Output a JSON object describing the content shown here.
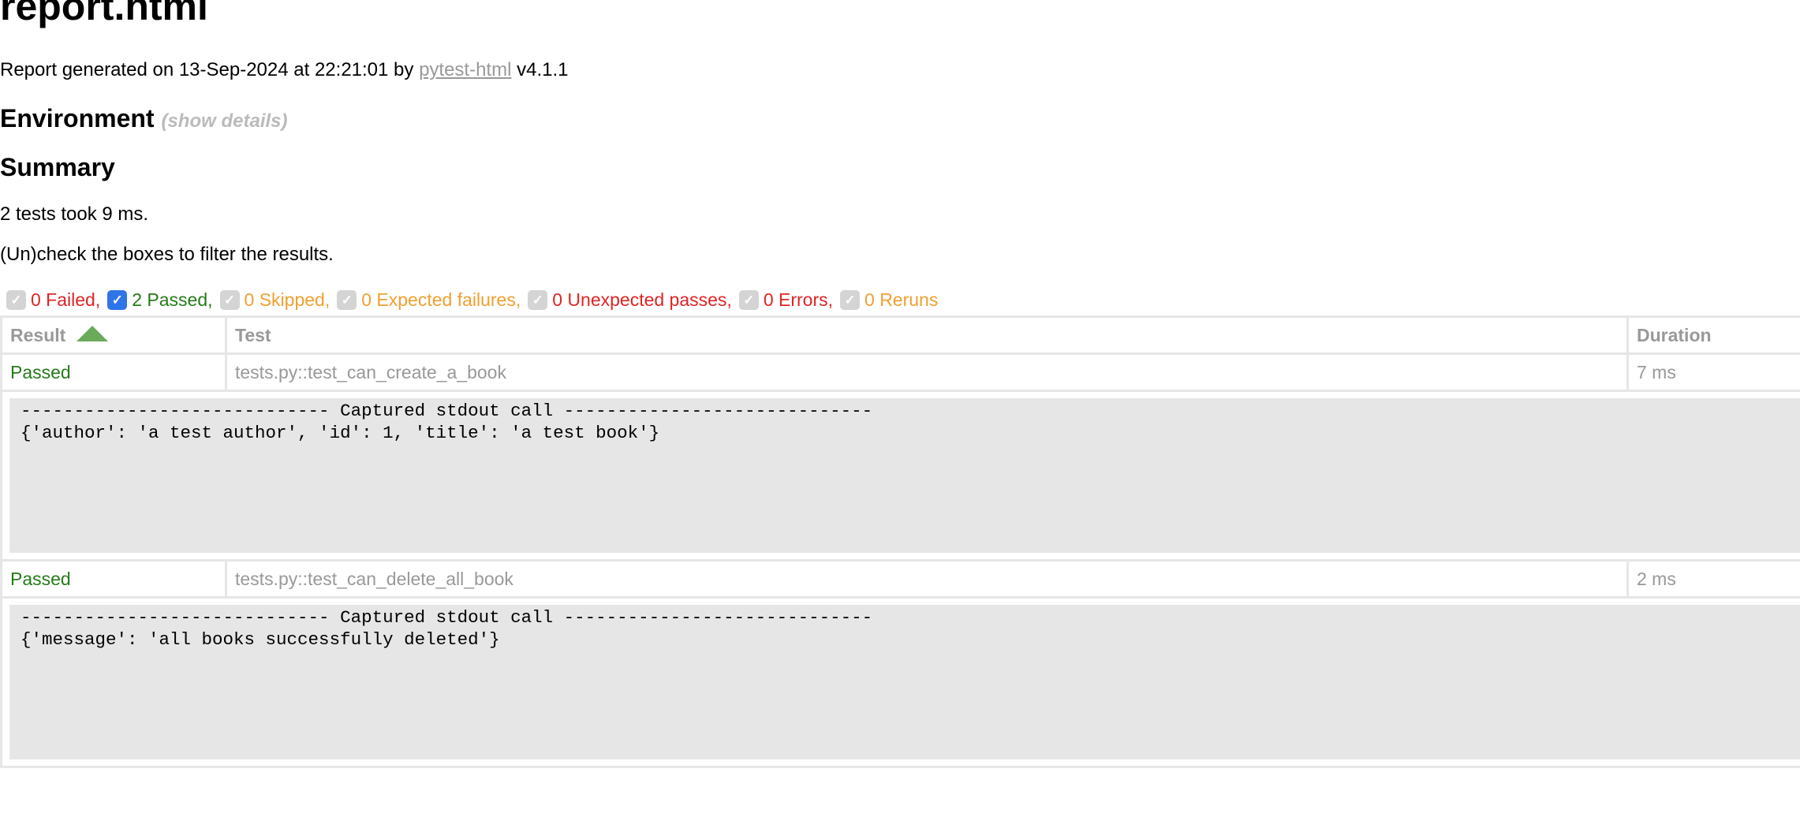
{
  "header": {
    "title": "report.html",
    "generated_prefix": "Report generated on 13-Sep-2024 at 22:21:01 by ",
    "generator_link": "pytest-html",
    "generator_version": " v4.1.1"
  },
  "environment": {
    "heading": "Environment",
    "toggle_label": "(show details)"
  },
  "summary": {
    "heading": "Summary",
    "run_count": "2 tests took 9 ms.",
    "filter_hint": "(Un)check the boxes to filter the results.",
    "filters": [
      {
        "label": "0 Failed,",
        "checked": true,
        "disabled": true,
        "color": "#e02424"
      },
      {
        "label": "2 Passed,",
        "checked": true,
        "disabled": false,
        "color": "#267a1a"
      },
      {
        "label": "0 Skipped,",
        "checked": true,
        "disabled": true,
        "color": "#f0a030"
      },
      {
        "label": "0 Expected failures,",
        "checked": true,
        "disabled": true,
        "color": "#f0a030"
      },
      {
        "label": "0 Unexpected passes,",
        "checked": true,
        "disabled": true,
        "color": "#e02424"
      },
      {
        "label": "0 Errors,",
        "checked": true,
        "disabled": true,
        "color": "#e02424"
      },
      {
        "label": "0 Reruns",
        "checked": true,
        "disabled": true,
        "color": "#f0a030"
      }
    ],
    "checkbox_icon": "checkmark-icon"
  },
  "table": {
    "columns": [
      "Result",
      "Test",
      "Duration"
    ],
    "sort_icon": "sort-ascending-icon",
    "rows": [
      {
        "result": "Passed",
        "test": "tests.py::test_can_create_a_book",
        "duration": "7 ms",
        "log": "----------------------------- Captured stdout call -----------------------------\n{'author': 'a test author', 'id': 1, 'title': 'a test book'}"
      },
      {
        "result": "Passed",
        "test": "tests.py::test_can_delete_all_book",
        "duration": "2 ms",
        "log": "----------------------------- Captured stdout call -----------------------------\n{'message': 'all books successfully deleted'}"
      }
    ]
  },
  "colors": {
    "passed": "#267a1a",
    "failed": "#e02424",
    "skipped": "#f0a030",
    "muted_text": "#999999",
    "log_background": "#e6e6e6",
    "checkbox_active": "#2f74e8",
    "sort_arrow": "#6aaa5a"
  }
}
